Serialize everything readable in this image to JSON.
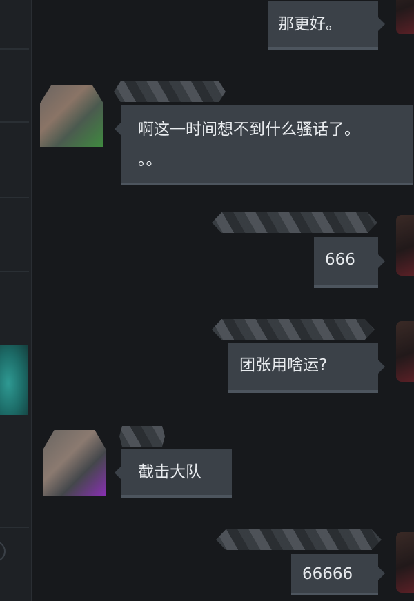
{
  "messages": [
    {
      "side": "right",
      "text": "那更好。"
    },
    {
      "side": "left",
      "text_line1": "啊这一时间想不到什么骚话了。",
      "text_line2": "。。"
    },
    {
      "side": "right",
      "text": "666"
    },
    {
      "side": "right",
      "text": "团张用啥运?"
    },
    {
      "side": "left",
      "text": "截击大队"
    },
    {
      "side": "right",
      "text": "66666"
    }
  ],
  "colors": {
    "background": "#17191c",
    "bubble": "#3b4148",
    "bubble_border": "#4d555e",
    "text": "#e9ecef",
    "sidebar_accent": "#2f9a93"
  }
}
